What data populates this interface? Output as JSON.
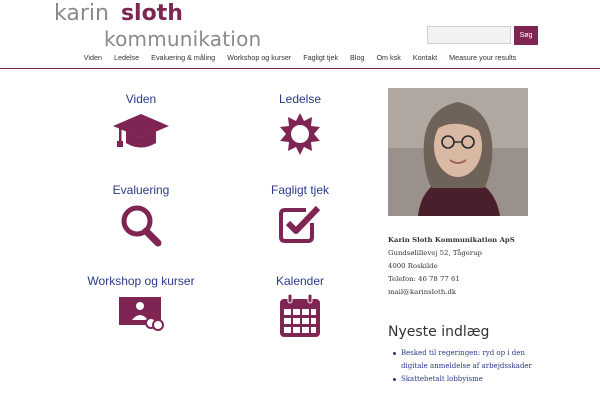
{
  "header": {
    "logo_word1": "karin",
    "logo_word2": "sloth",
    "logo_word3": "kommunikation",
    "search_placeholder": "",
    "search_button": "Søg"
  },
  "nav": {
    "items": [
      {
        "label": "Viden"
      },
      {
        "label": "Ledelse"
      },
      {
        "label": "Evaluering & måling"
      },
      {
        "label": "Workshop og kurser"
      },
      {
        "label": "Fagligt tjek"
      },
      {
        "label": "Blog"
      },
      {
        "label": "Om ksk"
      },
      {
        "label": "Kontakt"
      },
      {
        "label": "Measure your results"
      }
    ]
  },
  "tiles": [
    {
      "title": "Viden",
      "icon": "graduation-cap-icon"
    },
    {
      "title": "Ledelse",
      "icon": "sun-icon"
    },
    {
      "title": "Evaluering",
      "icon": "magnifier-icon"
    },
    {
      "title": "Fagligt tjek",
      "icon": "checkbox-icon"
    },
    {
      "title": "Workshop og kurser",
      "icon": "presentation-icon"
    },
    {
      "title": "Kalender",
      "icon": "calendar-icon"
    }
  ],
  "sidebar": {
    "company": "Karin Sloth Kommunikation ApS",
    "address": "Gundsølillevej 52, Tågerup",
    "city": "4000 Roskilde",
    "phone": "Telefon: 46 78 77 61",
    "email": "mail@karinsloth.dk",
    "recent_title": "Nyeste indlæg",
    "posts": [
      {
        "title": "Besked til regeringen: ryd op i den digitale anmeldelse af arbejdsskader"
      },
      {
        "title": "Skattebetalt lobbyisme"
      }
    ]
  },
  "colors": {
    "brand": "#7e2554",
    "link": "#2a3a8a",
    "logo_grey": "#8a8a8a"
  }
}
